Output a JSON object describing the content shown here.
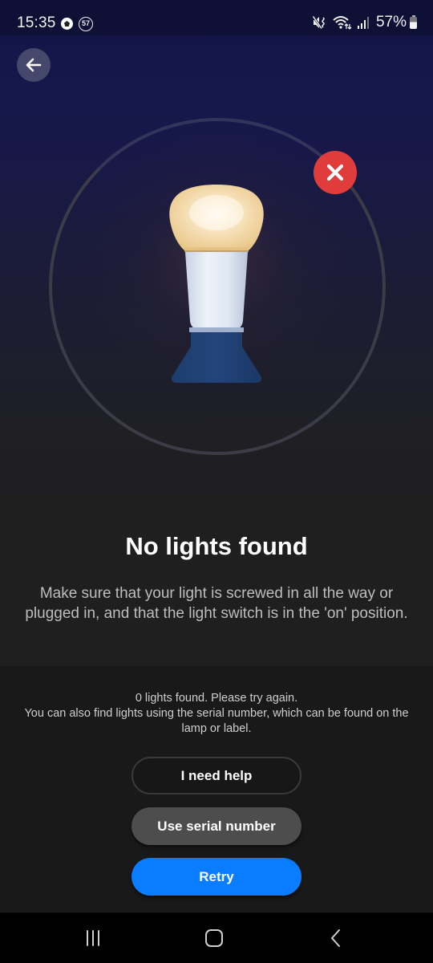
{
  "status_bar": {
    "time": "15:35",
    "notification_badge": "57",
    "battery_percent": "57%",
    "icons": [
      "soccer-ball-icon",
      "notification-count-icon",
      "mute-vibrate-icon",
      "wifi-icon",
      "signal-icon",
      "battery-icon"
    ]
  },
  "header": {
    "back_icon": "arrow-left-icon"
  },
  "illustration": {
    "subject": "light-bulb",
    "status_icon": "close-icon",
    "status_color": "#e03c3c"
  },
  "main": {
    "title": "No lights found",
    "description": "Make sure that your light is screwed in all the way or plugged in, and that the light switch is in the 'on' position."
  },
  "panel": {
    "message_line1": "0 lights found. Please try again.",
    "message_line2": "You can also find lights using the serial number, which can be found on the lamp or label.",
    "buttons": {
      "help": "I need help",
      "serial": "Use serial number",
      "retry": "Retry"
    },
    "accent_color": "#0a7cff"
  },
  "nav_bar": {
    "items": [
      "recent-apps-icon",
      "home-icon",
      "back-icon"
    ]
  }
}
